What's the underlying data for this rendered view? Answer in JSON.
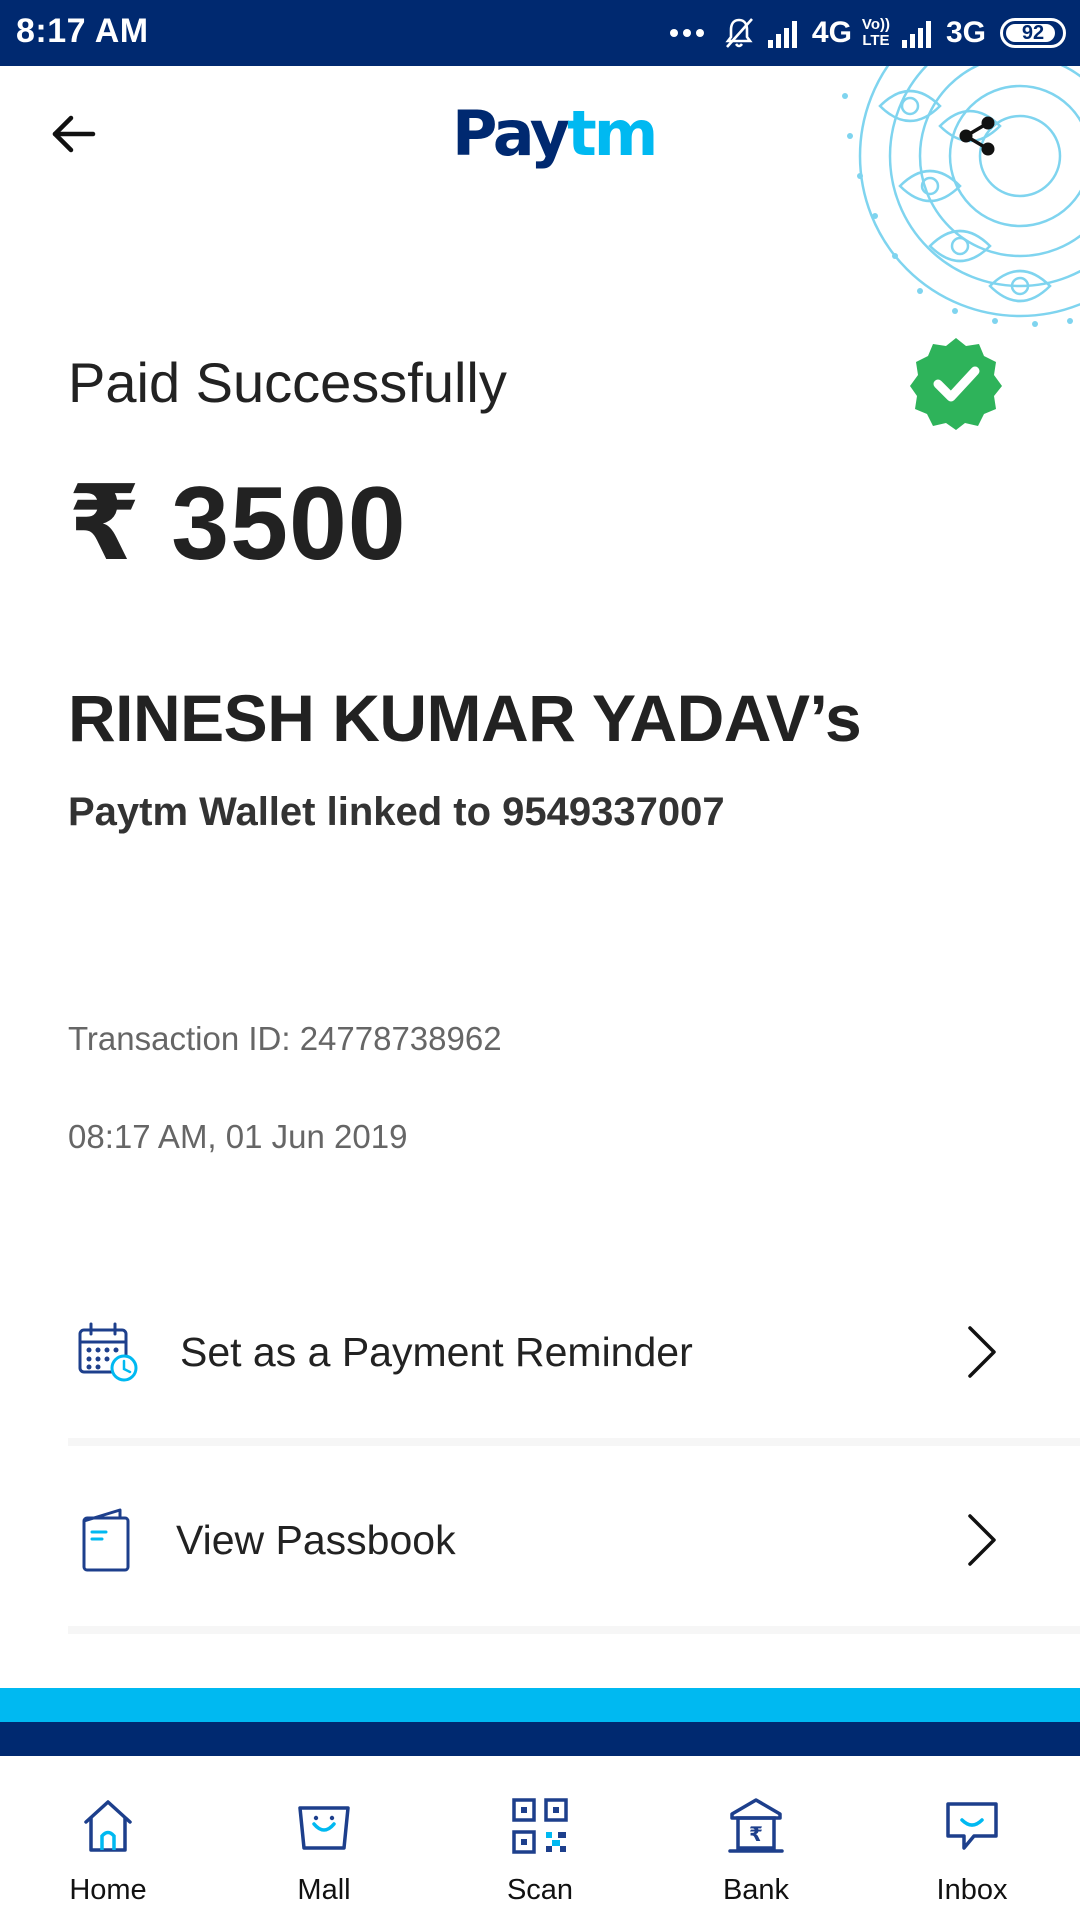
{
  "status_bar": {
    "time": "8:17 AM",
    "network_1": "4G",
    "volte_line1": "Vo))",
    "volte_line2": "LTE",
    "network_2": "3G",
    "battery": "92"
  },
  "header": {
    "logo_part1": "Pay",
    "logo_part2": "tm",
    "back_icon": "arrow-left-icon",
    "share_icon": "share-icon"
  },
  "payment": {
    "status_title": "Paid Successfully",
    "amount": "₹ 3500",
    "payee_name": "RINESH KUMAR YADAV’s",
    "payee_detail": "Paytm Wallet linked to 9549337007",
    "transaction_id": "Transaction ID: 24778738962",
    "timestamp": "08:17 AM, 01 Jun 2019"
  },
  "actions": [
    {
      "label": "Set as a Payment Reminder",
      "icon": "calendar-clock-icon"
    },
    {
      "label": "View Passbook",
      "icon": "passbook-icon"
    }
  ],
  "bottom_nav": [
    {
      "label": "Home",
      "icon": "home-icon"
    },
    {
      "label": "Mall",
      "icon": "mall-icon"
    },
    {
      "label": "Scan",
      "icon": "qr-scan-icon"
    },
    {
      "label": "Bank",
      "icon": "bank-icon"
    },
    {
      "label": "Inbox",
      "icon": "inbox-icon"
    }
  ],
  "colors": {
    "brand_dark": "#002970",
    "brand_light": "#00b9f1",
    "success": "#2eb35a",
    "text_primary": "#222222",
    "text_secondary": "#666666"
  }
}
